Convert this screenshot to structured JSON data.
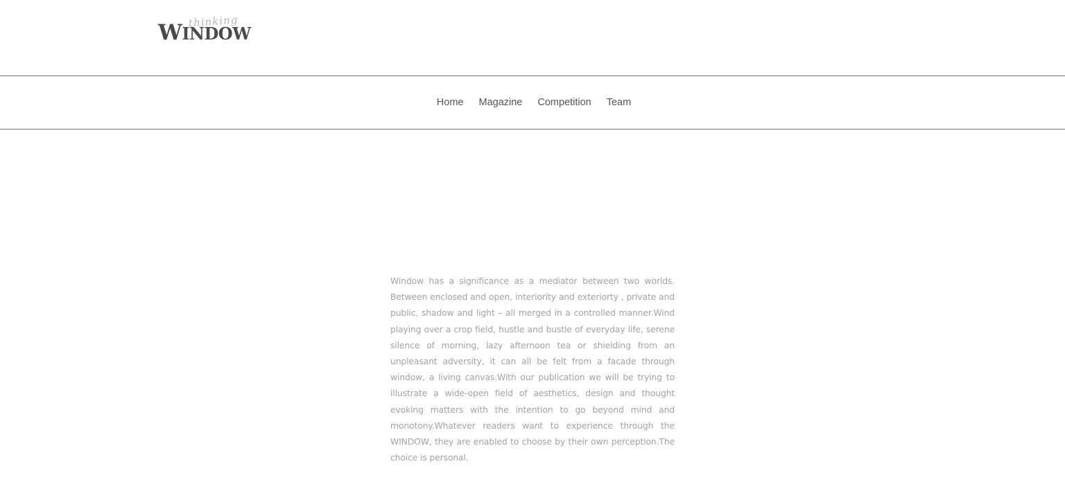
{
  "header": {
    "logo": {
      "main": "WINDOW",
      "script": "thinking"
    }
  },
  "nav": {
    "items": [
      {
        "label": "Home"
      },
      {
        "label": "Magazine"
      },
      {
        "label": "Competition"
      },
      {
        "label": "Team"
      }
    ]
  },
  "main": {
    "about_text": "Window has a significance as a mediator between two worlds. Between enclosed and open, interiority and exteriorty , private and public, shadow and light – all merged in a controlled manner.Wind playing over a crop field, hustle and bustle of everyday life, serene silence of morning, lazy afternoon tea or shielding from an unpleasant adversity, it can all be felt from a facade through window, a living canvas.With our publication we will be trying to illustrate a wide-open field of aesthetics, design and thought evoking matters with the intention to go beyond mind and monotony.Whatever readers want to experience through the WINDOW, they are enabled to choose by their own perception.The choice is personal."
  },
  "colors": {
    "background": "#ffffff",
    "rule": "#6f6f6f",
    "nav_text": "#555555",
    "body_text": "#a3a3a3",
    "logo_main": "#4a4a4a",
    "logo_script": "#b7b7b7"
  }
}
